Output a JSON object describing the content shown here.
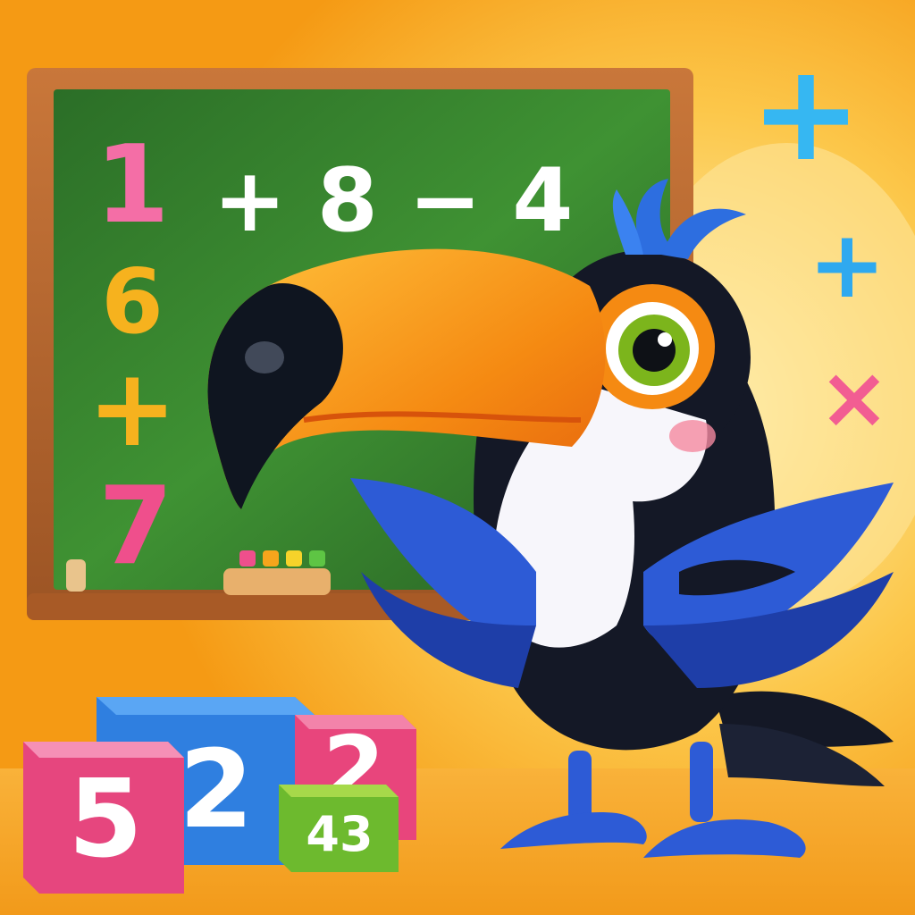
{
  "chalkboard": {
    "equation": "+ 8 − 4",
    "column_digits": [
      "1",
      "6",
      "+",
      "7"
    ]
  },
  "floating_symbols": [
    "+",
    "+",
    "×"
  ],
  "blocks": {
    "pink_left": "5",
    "blue_middle": "2",
    "pink_right": "2",
    "green_front": "43"
  },
  "colors": {
    "background": "#f7a21c",
    "board": "#2f7a2a",
    "frame": "#b5652a",
    "beak": "#f28a12",
    "bird_black": "#141826",
    "bird_blue": "#2d5bd6",
    "accent_pink": "#ef4f8c",
    "accent_cyan": "#36b7f2"
  }
}
